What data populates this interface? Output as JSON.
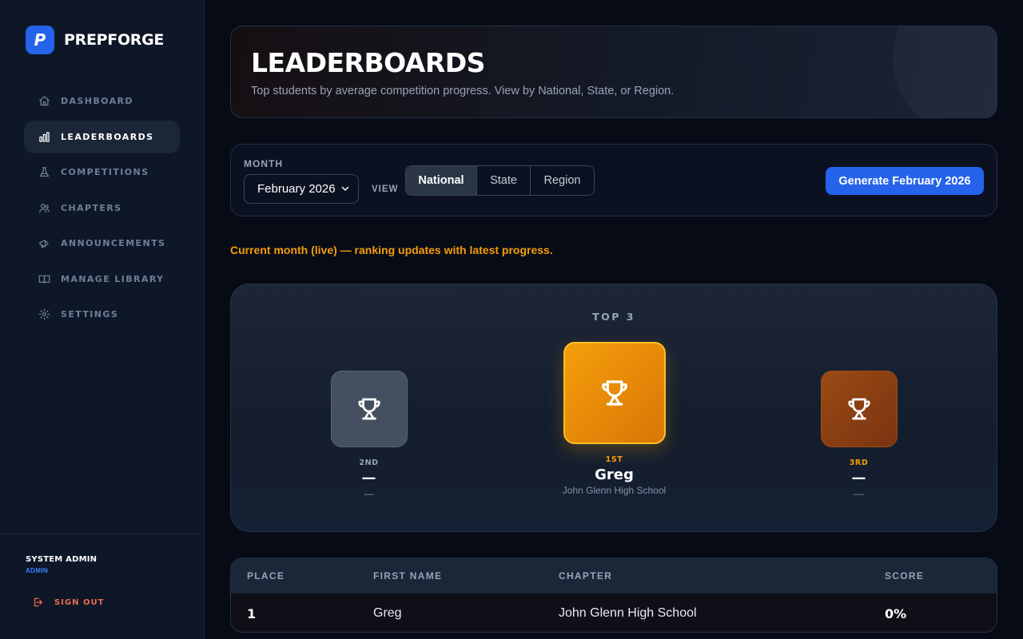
{
  "app": {
    "name": "PREPFORGE",
    "logo_letter": "P"
  },
  "sidebar": {
    "items": [
      {
        "label": "DASHBOARD",
        "icon": "home-icon",
        "active": false
      },
      {
        "label": "LEADERBOARDS",
        "icon": "bar-chart-icon",
        "active": true
      },
      {
        "label": "COMPETITIONS",
        "icon": "flask-icon",
        "active": false
      },
      {
        "label": "CHAPTERS",
        "icon": "users-icon",
        "active": false
      },
      {
        "label": "ANNOUNCEMENTS",
        "icon": "megaphone-icon",
        "active": false
      },
      {
        "label": "MANAGE LIBRARY",
        "icon": "book-icon",
        "active": false
      },
      {
        "label": "SETTINGS",
        "icon": "gear-icon",
        "active": false
      }
    ],
    "user": {
      "name": "SYSTEM ADMIN",
      "role": "ADMIN"
    },
    "signout_label": "SIGN OUT"
  },
  "header": {
    "title": "LEADERBOARDS",
    "subtitle": "Top students by average competition progress. View by National, State, or Region."
  },
  "filters": {
    "month_label": "MONTH",
    "month_value": "February 2026",
    "view_label": "VIEW",
    "views": [
      "National",
      "State",
      "Region"
    ],
    "active_view": "National",
    "generate_label": "Generate February 2026"
  },
  "live_note": "Current month (live) — ranking updates with latest progress.",
  "podium": {
    "label": "TOP 3",
    "first": {
      "rank": "1ST",
      "name": "Greg",
      "chapter": "John Glenn High School"
    },
    "second": {
      "rank": "2ND",
      "name": "—",
      "chapter": "—"
    },
    "third": {
      "rank": "3RD",
      "name": "—",
      "chapter": "—"
    }
  },
  "table": {
    "columns": [
      "PLACE",
      "FIRST NAME",
      "CHAPTER",
      "SCORE"
    ],
    "rows": [
      {
        "place": "1",
        "first_name": "Greg",
        "chapter": "John Glenn High School",
        "score": "0%"
      }
    ]
  },
  "colors": {
    "accent": "#2563eb",
    "gold": "#f59e0b",
    "silver": "#44505f",
    "bronze": "#9a4a14",
    "signout": "#ef6a4c"
  }
}
